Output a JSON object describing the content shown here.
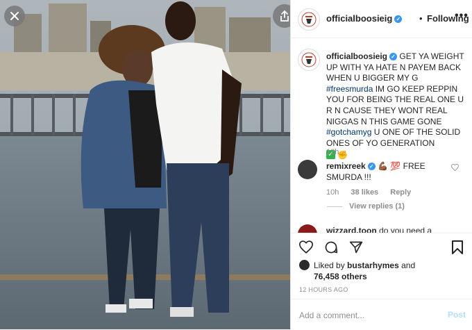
{
  "photo": {
    "description_icon": "photo-image"
  },
  "header": {
    "username": "officialboosieig",
    "dot": "•",
    "follow_label": "Following",
    "more_label": "•••"
  },
  "caption": {
    "username": "officialboosieig",
    "text_1": "GET YA WEIGHT UP WITH YA HATE N PAYEM BACK WHEN U BIGGER MY G",
    "tag_1": "#freesmurda",
    "text_2": "IM GO KEEP REPPIN YOU FOR BEING THE REAL ONE U R N CAUSE THEY WONT REAL NIGGAS N THIS GAME GONE",
    "tag_2": "#gotchamyg",
    "text_3": "U ONE OF THE SOLID ONES OF YO GENERATION",
    "time": "12h"
  },
  "comment": {
    "username": "remixreek",
    "text": "FREE SMURDA !!!",
    "emoji_1": "💪🏾",
    "emoji_2": "💯",
    "time": "10h",
    "likes": "38 likes",
    "reply": "Reply",
    "view_replies": "View replies (1)"
  },
  "comment2": {
    "username": "wizzard.toon",
    "text": "do you need a"
  },
  "likes": {
    "prefix": "Liked by",
    "user": "bustarhymes",
    "and": "and",
    "others": "76,458 others"
  },
  "time_ago": "12 HOURS AGO",
  "add_comment": {
    "placeholder": "Add a comment...",
    "post_label": "Post"
  },
  "colors": {
    "link": "#003569",
    "verified": "#3897f0",
    "post_disabled": "#b2dffc",
    "muted": "#8e8e8e"
  }
}
